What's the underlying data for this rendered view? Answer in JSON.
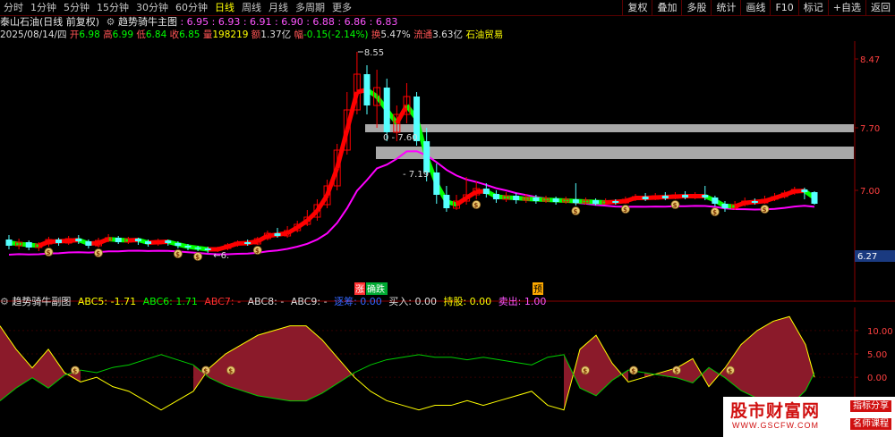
{
  "toolbar": {
    "tabs": [
      "分时",
      "1分钟",
      "5分钟",
      "15分钟",
      "30分钟",
      "60分钟",
      "日线",
      "周线",
      "月线",
      "多周期",
      "更多"
    ],
    "active": "日线",
    "right_buttons": [
      "复权",
      "叠加",
      "多股",
      "统计",
      "画线",
      "F10",
      "标记",
      "+自选",
      "返回"
    ]
  },
  "header": {
    "stock": "泰山石油(日线 前复权)",
    "indicator": "趋势骑牛主图",
    "indicator_values": ": 6.95 : 6.93 : 6.91 : 6.90 : 6.88 : 6.86 : 6.83"
  },
  "quote": {
    "date": "2025/08/14/四",
    "open_label": "开",
    "open": "6.98",
    "high_label": "高",
    "high": "6.99",
    "low_label": "低",
    "low": "6.84",
    "close_label": "收",
    "close": "6.85",
    "vol_label": "量",
    "vol": "198219",
    "amt_label": "额",
    "amt": "1.37亿",
    "chg_label": "幅",
    "chg": "-0.15(-2.14%)",
    "turn_label": "换",
    "turn": "5.47%",
    "float_label": "流通",
    "float": "3.63亿",
    "sector": "石油贸易"
  },
  "main_axis": [
    "8.47",
    "7.70",
    "7.00",
    "6.27"
  ],
  "annotations": {
    "peak": "8.55",
    "low": "6.",
    "level1": "7.60",
    "level2": "7.19"
  },
  "signals": [
    "涨",
    "确跌",
    "预"
  ],
  "sub": {
    "title": "趋势骑牛副图",
    "abc5": "ABC5: -1.71",
    "abc6": "ABC6: 1.71",
    "abc7": "ABC7: -",
    "abc8": "ABC8: -",
    "abc9": "ABC9: -",
    "zhu": "逐筹: 0.00",
    "buy": "买入: 0.00",
    "hold": "持股: 0.00",
    "sell": "卖出: 1.00",
    "axis": [
      "10.00",
      "5.00",
      "0.00"
    ]
  },
  "watermark": {
    "main": "股市财富网",
    "url": "WWW.GSCFW.COM",
    "tag1": "指标分享",
    "tag2": "名师课程"
  },
  "colors": {
    "up": "#ff0000",
    "down": "#00ff00",
    "cyan": "#55ffff",
    "ma": "#ff00ff",
    "yellow": "#ffff00",
    "axis": "#8b0000"
  },
  "chart_data": {
    "type": "candlestick",
    "price_range": [
      6.27,
      8.55
    ],
    "candles": [
      [
        6.45,
        6.38,
        6.5,
        6.34
      ],
      [
        6.38,
        6.42,
        6.46,
        6.34
      ],
      [
        6.42,
        6.36,
        6.44,
        6.33
      ],
      [
        6.36,
        6.4,
        6.42,
        6.32
      ],
      [
        6.4,
        6.45,
        6.48,
        6.37
      ],
      [
        6.45,
        6.41,
        6.47,
        6.38
      ],
      [
        6.41,
        6.46,
        6.49,
        6.39
      ],
      [
        6.46,
        6.43,
        6.5,
        6.4
      ],
      [
        6.43,
        6.38,
        6.45,
        6.35
      ],
      [
        6.38,
        6.44,
        6.47,
        6.36
      ],
      [
        6.44,
        6.47,
        6.51,
        6.42
      ],
      [
        6.47,
        6.42,
        6.49,
        6.4
      ],
      [
        6.42,
        6.46,
        6.48,
        6.4
      ],
      [
        6.46,
        6.43,
        6.47,
        6.39
      ],
      [
        6.43,
        6.4,
        6.45,
        6.37
      ],
      [
        6.4,
        6.44,
        6.46,
        6.38
      ],
      [
        6.44,
        6.41,
        6.45,
        6.38
      ],
      [
        6.41,
        6.38,
        6.43,
        6.35
      ],
      [
        6.38,
        6.36,
        6.4,
        6.33
      ],
      [
        6.36,
        6.35,
        6.38,
        6.32
      ],
      [
        6.35,
        6.33,
        6.37,
        6.3
      ],
      [
        6.33,
        6.35,
        6.37,
        6.31
      ],
      [
        6.35,
        6.39,
        6.41,
        6.33
      ],
      [
        6.39,
        6.42,
        6.44,
        6.37
      ],
      [
        6.42,
        6.4,
        6.45,
        6.38
      ],
      [
        6.4,
        6.46,
        6.48,
        6.39
      ],
      [
        6.46,
        6.52,
        6.55,
        6.44
      ],
      [
        6.52,
        6.49,
        6.58,
        6.47
      ],
      [
        6.49,
        6.55,
        6.6,
        6.47
      ],
      [
        6.55,
        6.62,
        6.66,
        6.53
      ],
      [
        6.62,
        6.7,
        6.78,
        6.6
      ],
      [
        6.7,
        6.84,
        6.9,
        6.66
      ],
      [
        6.84,
        7.05,
        7.12,
        6.8
      ],
      [
        7.05,
        7.45,
        7.52,
        7.0
      ],
      [
        7.45,
        7.9,
        8.1,
        7.4
      ],
      [
        7.9,
        8.3,
        8.55,
        7.85
      ],
      [
        8.3,
        7.95,
        8.4,
        7.85
      ],
      [
        7.95,
        8.15,
        8.35,
        7.7
      ],
      [
        8.15,
        7.65,
        8.25,
        7.55
      ],
      [
        7.65,
        7.85,
        7.95,
        7.55
      ],
      [
        7.85,
        8.05,
        8.2,
        7.75
      ],
      [
        8.05,
        7.55,
        8.1,
        7.5
      ],
      [
        7.55,
        7.2,
        7.7,
        7.1
      ],
      [
        7.2,
        6.95,
        7.3,
        6.85
      ],
      [
        6.95,
        6.8,
        7.05,
        6.76
      ],
      [
        6.8,
        6.88,
        6.95,
        6.78
      ],
      [
        6.88,
        6.95,
        7.15,
        6.84
      ],
      [
        6.95,
        7.02,
        7.1,
        6.9
      ],
      [
        7.02,
        6.96,
        7.08,
        6.92
      ],
      [
        6.96,
        6.9,
        7.0,
        6.86
      ],
      [
        6.9,
        6.94,
        6.98,
        6.87
      ],
      [
        6.94,
        6.89,
        6.97,
        6.85
      ],
      [
        6.89,
        6.92,
        6.96,
        6.86
      ],
      [
        6.92,
        6.88,
        6.95,
        6.85
      ],
      [
        6.88,
        6.91,
        6.94,
        6.86
      ],
      [
        6.91,
        6.87,
        6.93,
        6.84
      ],
      [
        6.87,
        6.9,
        6.93,
        6.85
      ],
      [
        6.9,
        6.86,
        7.08,
        6.83
      ],
      [
        6.86,
        6.89,
        6.92,
        6.84
      ],
      [
        6.89,
        6.85,
        6.91,
        6.83
      ],
      [
        6.85,
        6.88,
        6.91,
        6.84
      ],
      [
        6.88,
        6.86,
        6.9,
        6.84
      ],
      [
        6.86,
        6.9,
        6.93,
        6.85
      ],
      [
        6.9,
        6.93,
        6.96,
        6.88
      ],
      [
        6.93,
        6.9,
        6.97,
        6.88
      ],
      [
        6.9,
        6.94,
        6.97,
        6.89
      ],
      [
        6.94,
        6.91,
        6.98,
        6.89
      ],
      [
        6.91,
        6.95,
        6.98,
        6.9
      ],
      [
        6.95,
        6.92,
        6.99,
        6.9
      ],
      [
        6.92,
        6.95,
        6.98,
        6.9
      ],
      [
        6.95,
        6.92,
        7.05,
        6.89
      ],
      [
        6.92,
        6.85,
        6.94,
        6.82
      ],
      [
        6.85,
        6.8,
        6.88,
        6.76
      ],
      [
        6.8,
        6.84,
        6.88,
        6.78
      ],
      [
        6.84,
        6.88,
        6.92,
        6.82
      ],
      [
        6.88,
        6.86,
        6.91,
        6.84
      ],
      [
        6.86,
        6.9,
        6.94,
        6.85
      ],
      [
        6.9,
        6.93,
        6.97,
        6.88
      ],
      [
        6.93,
        6.97,
        7.0,
        6.91
      ],
      [
        6.97,
        7.01,
        7.04,
        6.95
      ],
      [
        7.01,
        6.98,
        7.03,
        6.9
      ],
      [
        6.98,
        6.85,
        6.99,
        6.84
      ]
    ]
  }
}
